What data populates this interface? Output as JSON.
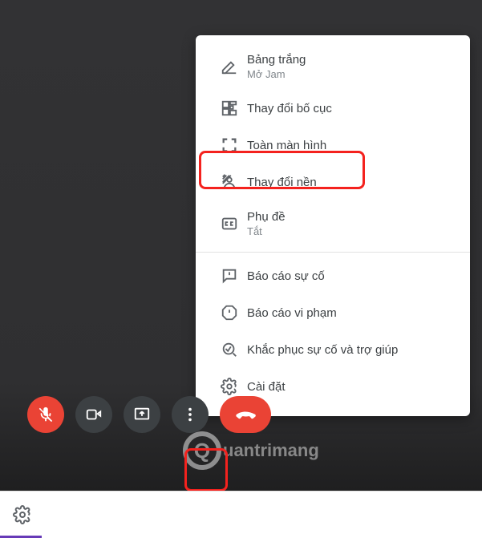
{
  "menu": {
    "items": [
      {
        "icon": "edit-icon",
        "title": "Bảng trắng",
        "sub": "Mở Jam"
      },
      {
        "icon": "layout-icon",
        "title": "Thay đổi bố cục"
      },
      {
        "icon": "fullscreen-icon",
        "title": "Toàn màn hình"
      },
      {
        "icon": "background-icon",
        "title": "Thay đổi nền",
        "highlight": true
      },
      {
        "icon": "captions-icon",
        "title": "Phụ đề",
        "sub": "Tắt"
      },
      {
        "sep": true
      },
      {
        "icon": "feedback-icon",
        "title": "Báo cáo sự cố"
      },
      {
        "icon": "report-icon",
        "title": "Báo cáo vi phạm"
      },
      {
        "icon": "troubleshoot-icon",
        "title": "Khắc phục sự cố và trợ giúp"
      },
      {
        "icon": "settings-icon",
        "title": "Cài đặt"
      }
    ]
  },
  "controls": {
    "mic": "mic-off-button",
    "camera": "camera-button",
    "present": "present-button",
    "more": "more-options-button",
    "hangup": "hangup-button"
  },
  "watermark": "uantrimang",
  "footer_icon": "settings-icon"
}
